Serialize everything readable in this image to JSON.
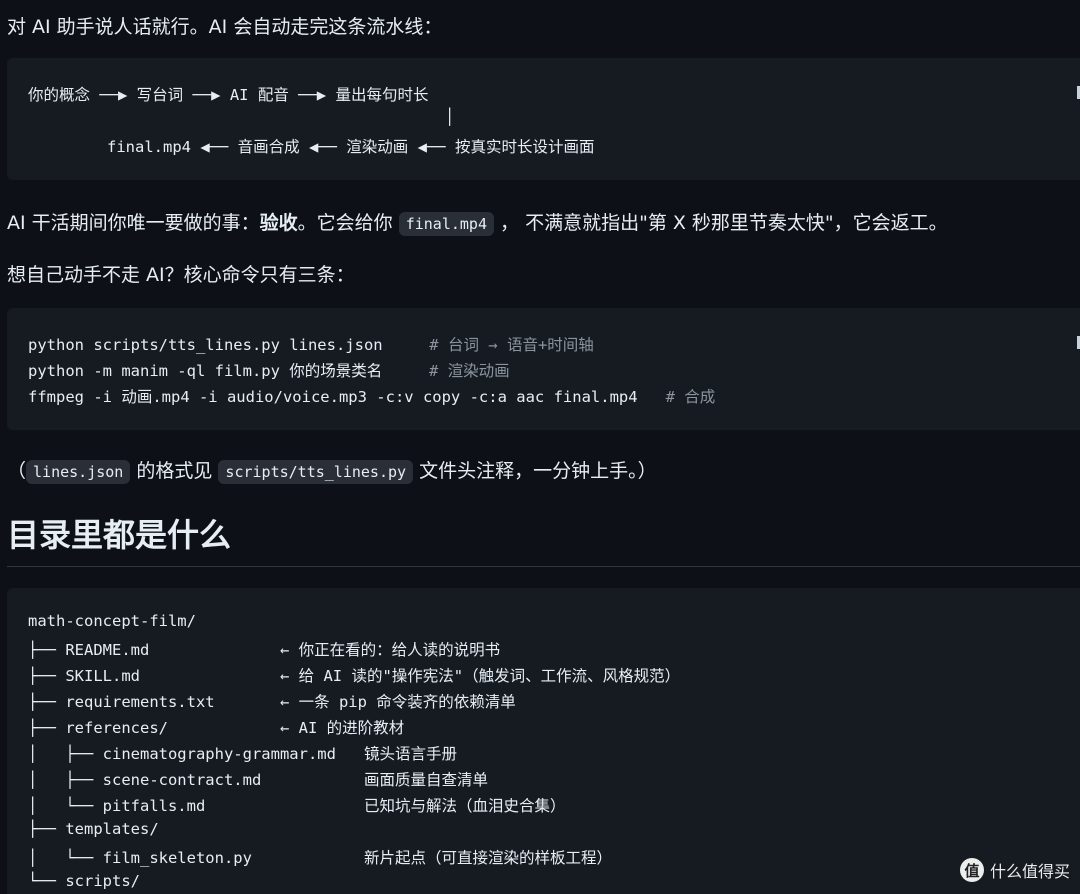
{
  "intro": "对 AI 助手说人话就行。AI 会自动走完这条流水线：",
  "pipeline": {
    "row1": "你的概念 ──▶ 写台词 ──▶ AI 配音 ──▶ 量出每句时长",
    "row_mid": "│",
    "row2": "final.mp4 ◀── 音画合成 ◀── 渲染动画 ◀── 按真实时长设计画面"
  },
  "accept": {
    "before": "AI 干活期间你唯一要做的事：",
    "bold": "验收",
    "mid": "。它会给你 ",
    "code": "final.mp4",
    "after": " ，  不满意就指出\"第 X 秒那里节奏太快\"，它会返工。"
  },
  "manual_intro": "想自己动手不走 AI？核心命令只有三条：",
  "commands": [
    {
      "cmd": "python scripts/tts_lines.py lines.json     ",
      "comment": "# 台词 → 语音+时间轴"
    },
    {
      "cmd": "python -m manim -ql film.py 你的场景类名     ",
      "comment": "# 渲染动画"
    },
    {
      "cmd": "ffmpeg -i 动画.mp4 -i audio/voice.mp3 -c:v copy -c:a aac final.mp4   ",
      "comment": "# 合成"
    }
  ],
  "format_note": {
    "open": "（",
    "code1": "lines.json",
    "mid": " 的格式见 ",
    "code2": "scripts/tts_lines.py",
    "after": " 文件头注释，一分钟上手。）"
  },
  "section_title": "目录里都是什么",
  "tree": [
    "math-concept-film/",
    "├── README.md              ← 你正在看的：给人读的说明书",
    "├── SKILL.md               ← 给 AI 读的\"操作宪法\"（触发词、工作流、风格规范）",
    "├── requirements.txt       ← 一条 pip 命令装齐的依赖清单",
    "├── references/            ← AI 的进阶教材",
    "│   ├── cinematography-grammar.md   镜头语言手册",
    "│   ├── scene-contract.md           画面质量自查清单",
    "│   └── pitfalls.md                 已知坑与解法（血泪史合集）",
    "├── templates/",
    "│   └── film_skeleton.py            新片起点（可直接渲染的样板工程）",
    "└── scripts/"
  ],
  "watermark": {
    "badge": "值",
    "text": "什么值得买"
  }
}
